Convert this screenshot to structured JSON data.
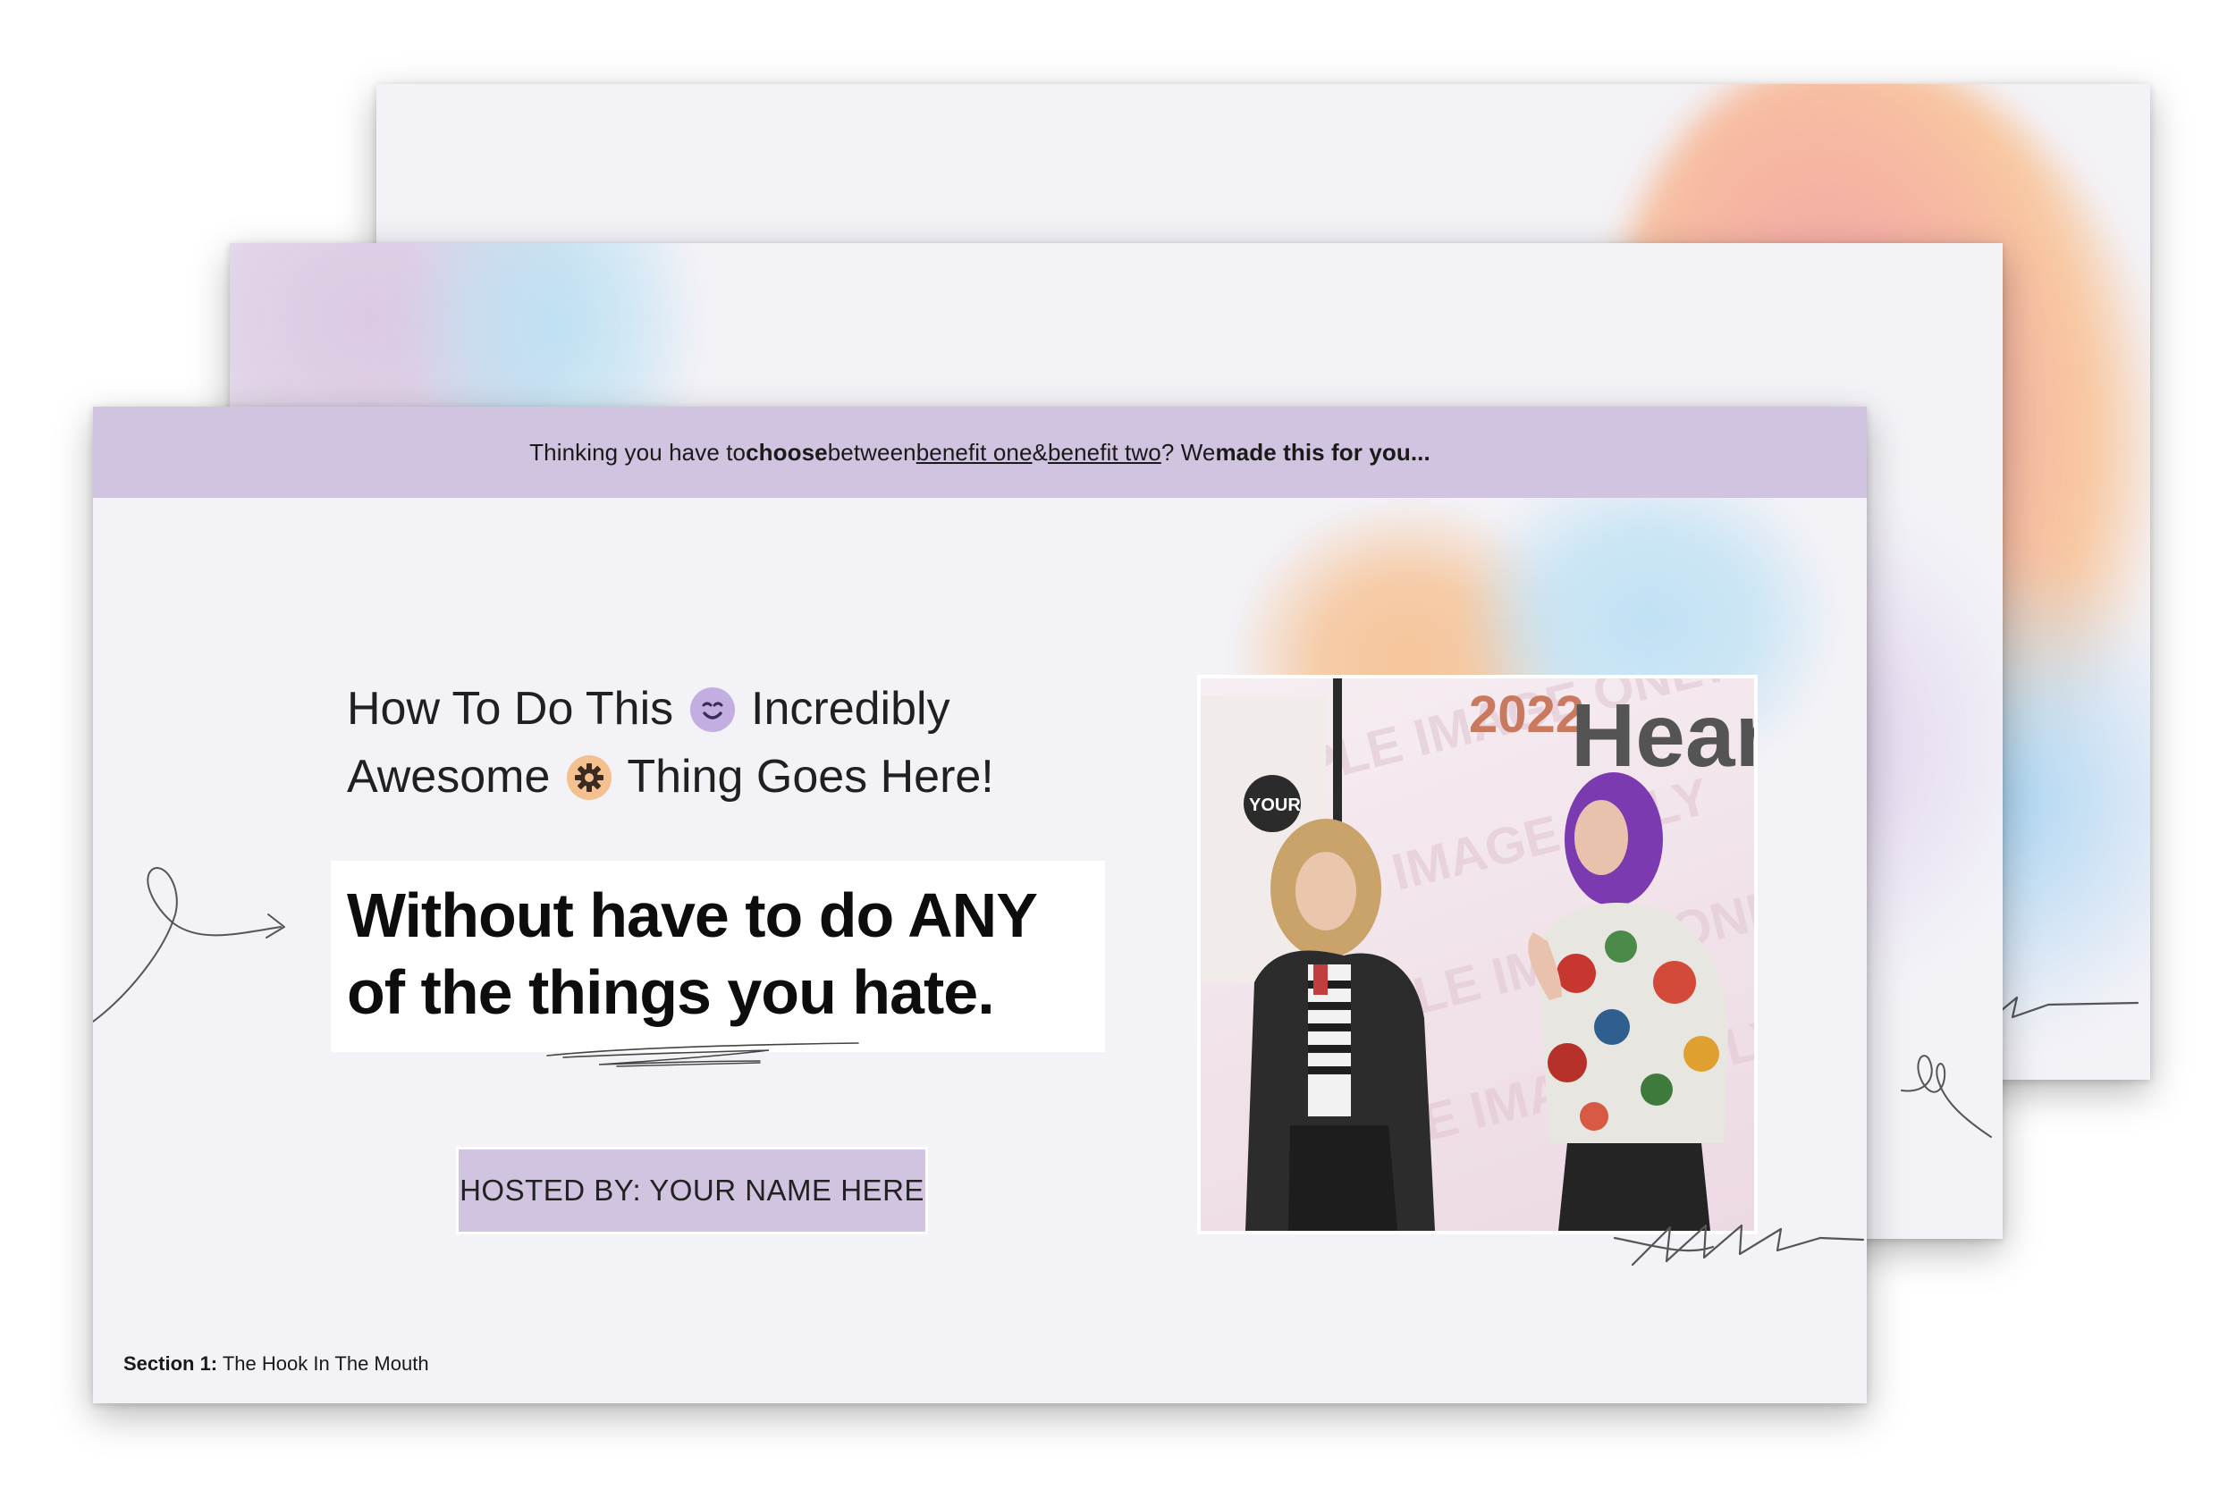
{
  "topbar": {
    "part1": "Thinking you have to ",
    "choose": "choose",
    "part2": " between ",
    "benefit_one": "benefit one",
    "amp": " & ",
    "benefit_two": "benefit two",
    "part3": "? We ",
    "made_this": "made this for you..."
  },
  "headline": {
    "line1_a": "How To Do This",
    "line1_b": "Incredibly",
    "line2_a": "Awesome",
    "line2_b": "Thing Goes Here!"
  },
  "subhead": {
    "line1": "Without have to do ANY",
    "line2": "of the things you hate."
  },
  "host_button": {
    "label": "HOSTED BY: YOUR NAME HERE"
  },
  "photo": {
    "banner_year": "2022",
    "banner_word": "Heart",
    "watermark": "SAMPLE IMAGE ONLY",
    "sign_text": "YOUR"
  },
  "section": {
    "label": "Section 1:",
    "title": " The Hook In The Mouth"
  },
  "colors": {
    "accent_lilac": "#d0c4e0",
    "slide_bg": "#f3f2f7",
    "blob_orange": "#f6c59a",
    "blob_blue": "#bfe1f4",
    "blob_pink": "#f4a3a6"
  },
  "icons": {
    "smile": "smiling-face-icon",
    "gear": "gear-icon"
  }
}
